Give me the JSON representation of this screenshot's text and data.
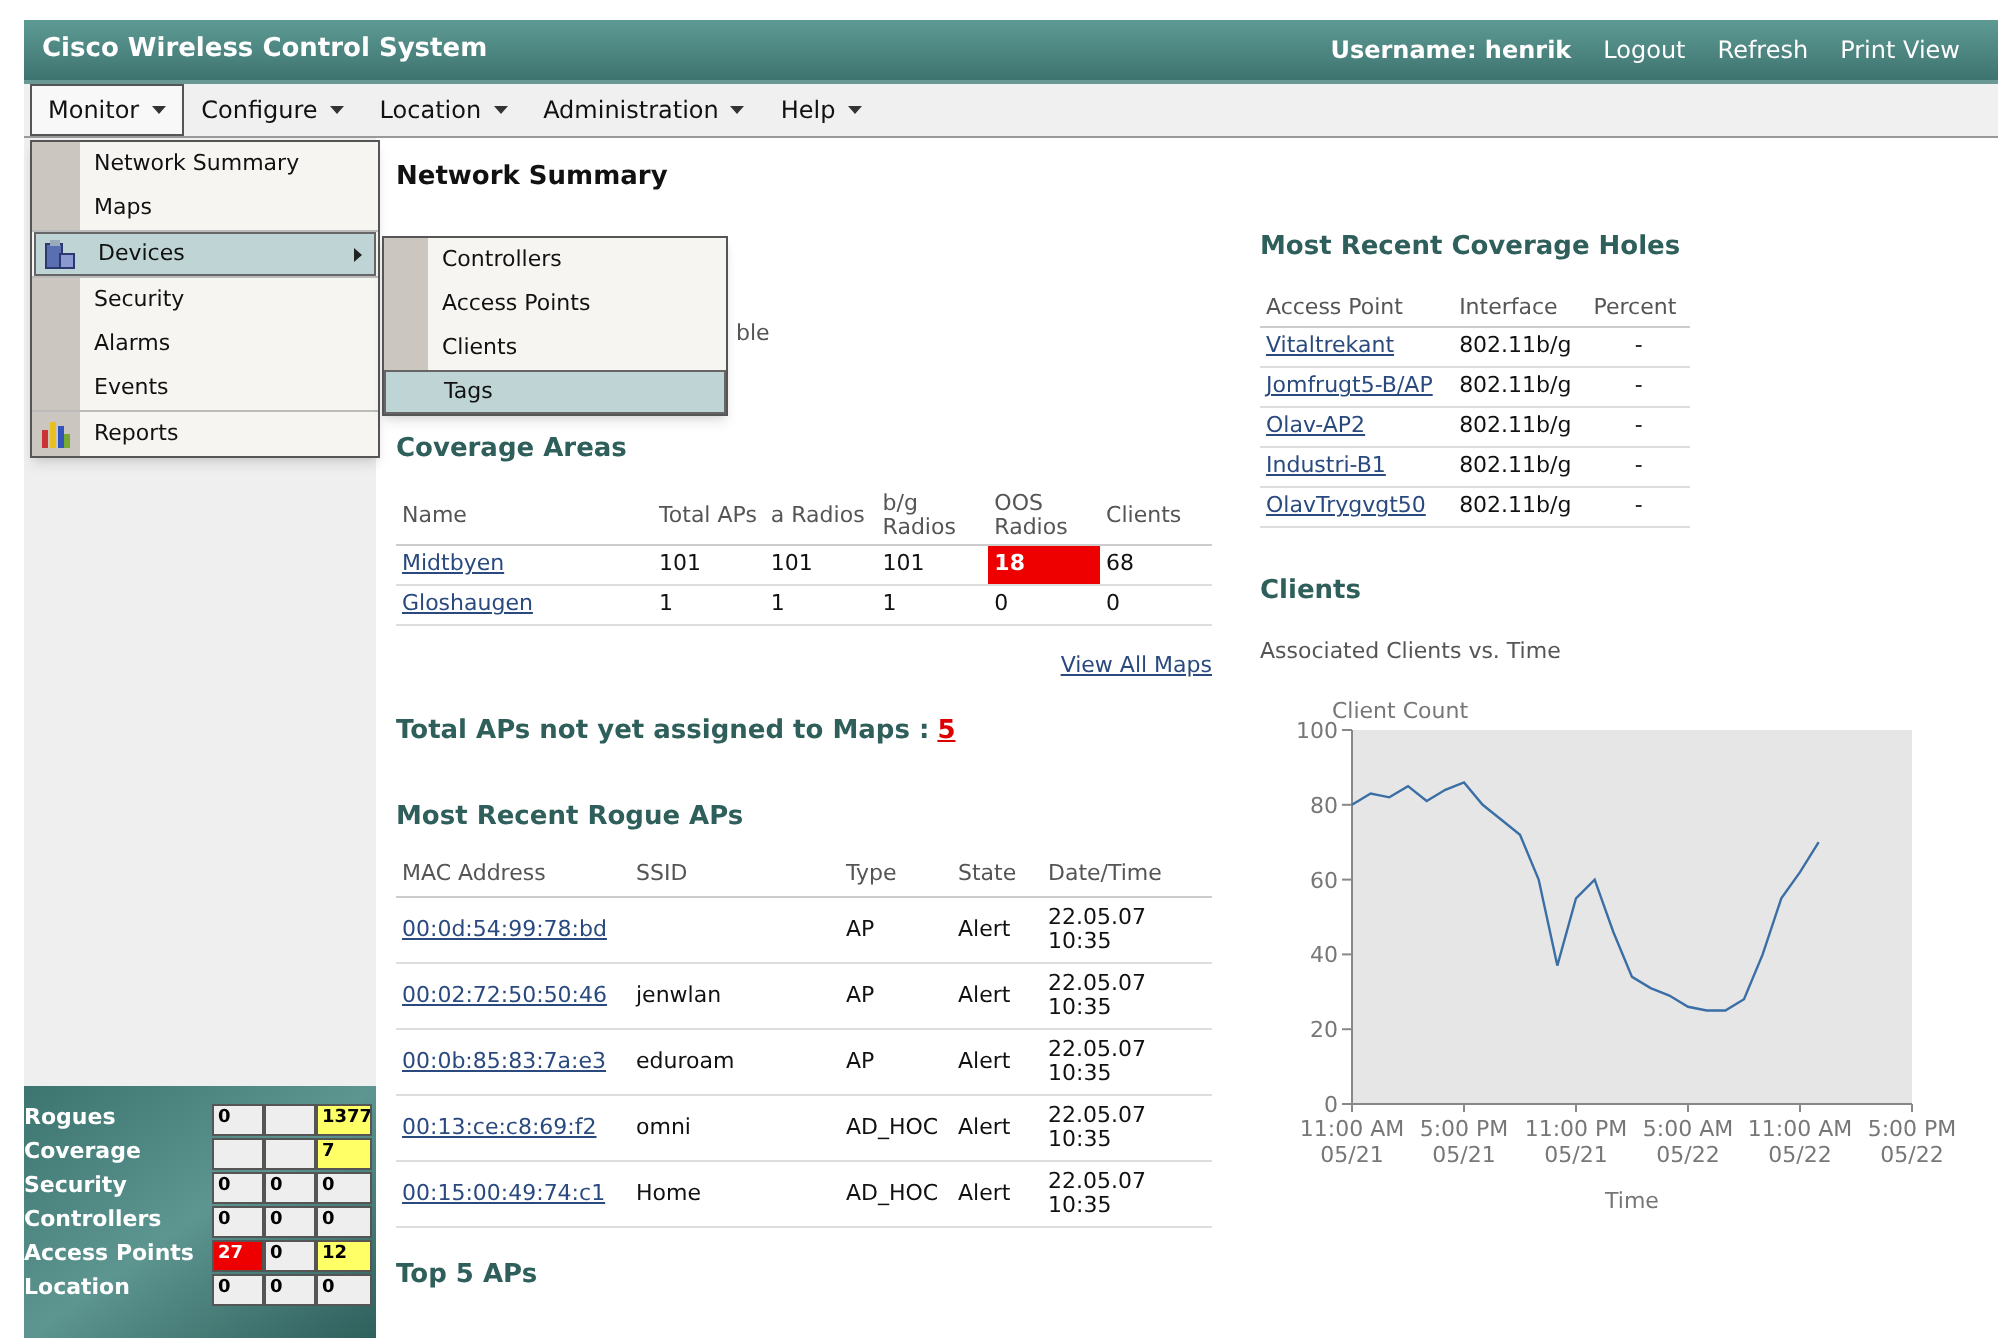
{
  "header": {
    "title": "Cisco Wireless Control System",
    "username": "Username: henrik",
    "links": [
      "Logout",
      "Refresh",
      "Print View"
    ]
  },
  "menubar": [
    {
      "label": "Monitor",
      "selected": true
    },
    {
      "label": "Configure",
      "selected": false
    },
    {
      "label": "Location",
      "selected": false
    },
    {
      "label": "Administration",
      "selected": false
    },
    {
      "label": "Help",
      "selected": false
    }
  ],
  "monitor_menu": {
    "groups": [
      [
        {
          "label": "Network Summary",
          "kind": "plain",
          "selected": false,
          "submenu": false
        },
        {
          "label": "Maps",
          "kind": "plain",
          "selected": false,
          "submenu": false
        }
      ],
      [
        {
          "label": "Devices",
          "kind": "devices",
          "selected": true,
          "submenu": true
        }
      ],
      [
        {
          "label": "Security",
          "kind": "plain",
          "selected": false,
          "submenu": false
        },
        {
          "label": "Alarms",
          "kind": "plain",
          "selected": false,
          "submenu": false
        },
        {
          "label": "Events",
          "kind": "plain",
          "selected": false,
          "submenu": false
        }
      ],
      [
        {
          "label": "Reports",
          "kind": "reports",
          "selected": false,
          "submenu": false
        }
      ]
    ]
  },
  "devices_submenu": [
    {
      "label": "Controllers",
      "selected": false
    },
    {
      "label": "Access Points",
      "selected": false
    },
    {
      "label": "Clients",
      "selected": false
    },
    {
      "label": "Tags",
      "selected": true
    }
  ],
  "page_title": "Network Summary",
  "covered_fragment": "ble",
  "coverage_areas": {
    "title": "Coverage Areas",
    "columns": [
      "Name",
      "Total APs",
      "a Radios",
      "b/g Radios",
      "OOS Radios",
      "Clients"
    ],
    "rows": [
      {
        "name": "Midtbyen",
        "total_aps": "101",
        "a_radios": "101",
        "bg_radios": "101",
        "oos_radios": "18",
        "oos_alert": true,
        "clients": "68"
      },
      {
        "name": "Gloshaugen",
        "total_aps": "1",
        "a_radios": "1",
        "bg_radios": "1",
        "oos_radios": "0",
        "oos_alert": false,
        "clients": "0"
      }
    ],
    "link": "View All Maps"
  },
  "unassigned": {
    "label": "Total APs not yet assigned to Maps :",
    "count": "5"
  },
  "rogue_aps": {
    "title": "Most Recent Rogue APs",
    "columns": [
      "MAC Address",
      "SSID",
      "Type",
      "State",
      "Date/Time"
    ],
    "rows": [
      {
        "mac": "00:0d:54:99:78:bd",
        "type": "AP",
        "state": "Alert",
        "date": "22.05.07",
        "time": "10:35"
      },
      {
        "mac": "00:02:72:50:50:46",
        "ssid": "jenwlan",
        "type": "AP",
        "state": "Alert",
        "date": "22.05.07",
        "time": "10:35"
      },
      {
        "mac": "00:0b:85:83:7a:e3",
        "ssid": "eduroam",
        "type": "AP",
        "state": "Alert",
        "date": "22.05.07",
        "time": "10:35"
      },
      {
        "mac": "00:13:ce:c8:69:f2",
        "ssid": "omni",
        "type": "AD_HOC",
        "state": "Alert",
        "date": "22.05.07",
        "time": "10:35"
      },
      {
        "mac": "00:15:00:49:74:c1",
        "ssid": "Home",
        "type": "AD_HOC",
        "state": "Alert",
        "date": "22.05.07",
        "time": "10:35"
      }
    ]
  },
  "top_aps_title": "Top 5 APs",
  "coverage_holes": {
    "title": "Most Recent Coverage Holes",
    "columns": [
      "Access Point",
      "Interface",
      "Percent"
    ],
    "rows": [
      {
        "ap": "Vitaltrekant",
        "interface": "802.11b/g",
        "percent": "-"
      },
      {
        "ap": "Jomfrugt5-B/AP",
        "interface": "802.11b/g",
        "percent": "-"
      },
      {
        "ap": "Olav-AP2",
        "interface": "802.11b/g",
        "percent": "-"
      },
      {
        "ap": "Industri-B1",
        "interface": "802.11b/g",
        "percent": "-"
      },
      {
        "ap": "OlavTrygvgt50",
        "interface": "802.11b/g",
        "percent": "-"
      }
    ]
  },
  "clients": {
    "title": "Clients",
    "subtitle": "Associated Clients vs. Time",
    "chart_data": {
      "type": "line",
      "xlabel": "Time",
      "ylabel": "Client Count",
      "categories": [
        "11:00 AM 05/21",
        null,
        null,
        null,
        null,
        null,
        "5:00 PM 05/21",
        null,
        null,
        null,
        null,
        null,
        "11:00 PM 05/21",
        null,
        null,
        null,
        null,
        null,
        "5:00 AM 05/22",
        null,
        null,
        null,
        null,
        null,
        "11:00 AM 05/22",
        null,
        null,
        null,
        null,
        null,
        "5:00 PM 05/22"
      ],
      "series": [
        {
          "color": "#3a6ea5",
          "values": [
            80,
            83,
            82,
            85,
            81,
            84,
            86,
            80,
            76,
            72,
            60,
            37,
            55,
            60,
            46,
            34,
            31,
            29,
            26,
            25,
            25,
            28,
            40,
            55,
            62,
            70,
            null,
            null,
            null,
            null,
            null
          ]
        }
      ],
      "ylim": [
        0,
        100
      ],
      "yticks": [
        0,
        20,
        40,
        60,
        80,
        100
      ]
    }
  },
  "alarm_summary": [
    {
      "label": "Rogues",
      "cells": [
        {
          "text": "0",
          "color": "#eeeeee"
        },
        {
          "text": "",
          "color": "#eeeeee"
        },
        {
          "text": "1377",
          "color": "#ffff66"
        }
      ]
    },
    {
      "label": "Coverage",
      "cells": [
        {
          "text": "",
          "color": "#eeeeee"
        },
        {
          "text": "",
          "color": "#eeeeee"
        },
        {
          "text": "7",
          "color": "#ffff66"
        }
      ]
    },
    {
      "label": "Security",
      "cells": [
        {
          "text": "0",
          "color": "#eeeeee"
        },
        {
          "text": "0",
          "color": "#eeeeee"
        },
        {
          "text": "0",
          "color": "#eeeeee"
        }
      ]
    },
    {
      "label": "Controllers",
      "cells": [
        {
          "text": "0",
          "color": "#eeeeee"
        },
        {
          "text": "0",
          "color": "#eeeeee"
        },
        {
          "text": "0",
          "color": "#eeeeee"
        }
      ]
    },
    {
      "label": "Access Points",
      "cells": [
        {
          "text": "27",
          "color": "#ee0000"
        },
        {
          "text": "0",
          "color": "#eeeeee"
        },
        {
          "text": "12",
          "color": "#ffff66"
        }
      ]
    },
    {
      "label": "Location",
      "cells": [
        {
          "text": "0",
          "color": "#eeeeee"
        },
        {
          "text": "0",
          "color": "#eeeeee"
        },
        {
          "text": "0",
          "color": "#eeeeee"
        }
      ]
    }
  ]
}
